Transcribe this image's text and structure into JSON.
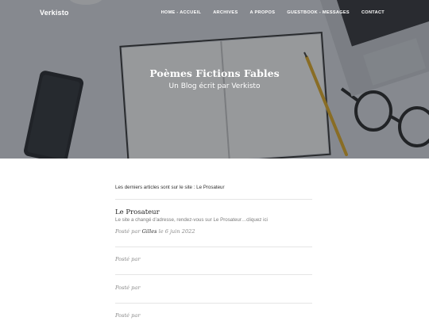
{
  "navbar": {
    "brand": "Verkisto",
    "items": [
      "HOME - ACCUEIL",
      "ARCHIVES",
      "A PROPOS",
      "GUESTBOOK - MESSAGES",
      "CONTACT"
    ]
  },
  "hero": {
    "title": "Poèmes Fictions Fables",
    "subtitle": "Un Blog écrit par Verkisto"
  },
  "main": {
    "intro": "Les derniers articles sont sur le site : Le Prosateur",
    "posts": [
      {
        "title": "Le Prosateur",
        "excerpt": "Le site a changé d’adresse, rendez-vous sur Le Prosateur…cliquez ici",
        "posted_by": "Posté par",
        "author": "Gilles",
        "date_prefix": "le",
        "date": "6 juin 2022"
      },
      {
        "posted_by": "Posté par"
      },
      {
        "posted_by": "Posté par"
      },
      {
        "posted_by": "Posté par"
      }
    ]
  },
  "colors": {
    "overlay": "#282c34",
    "text_dark": "#222222",
    "text_muted": "#8a8a8a"
  }
}
